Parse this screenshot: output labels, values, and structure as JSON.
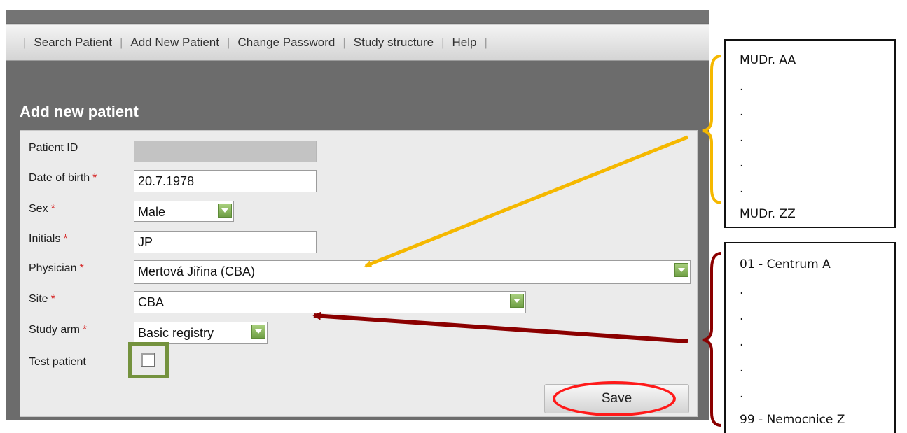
{
  "nav": {
    "items": [
      "Search Patient",
      "Add New Patient",
      "Change Password",
      "Study structure",
      "Help"
    ]
  },
  "page": {
    "title": "Add new patient"
  },
  "form": {
    "patient_id": {
      "label": "Patient ID",
      "value": ""
    },
    "date_of_birth": {
      "label": "Date of birth",
      "value": "20.7.1978"
    },
    "sex": {
      "label": "Sex",
      "value": "Male"
    },
    "initials": {
      "label": "Initials",
      "value": "JP"
    },
    "physician": {
      "label": "Physician",
      "value": "Mertová Jiřina (CBA)"
    },
    "site": {
      "label": "Site",
      "value": "CBA"
    },
    "study_arm": {
      "label": "Study arm",
      "value": "Basic registry"
    },
    "test_patient": {
      "label": "Test patient",
      "checked": false
    },
    "required_mark": "*",
    "save_label": "Save"
  },
  "annotations": {
    "physician_list": [
      "MUDr. AA",
      ".",
      ".",
      ".",
      ".",
      ".",
      "MUDr. ZZ"
    ],
    "site_list": [
      "01 - Centrum A",
      ".",
      ".",
      ".",
      ".",
      ".",
      "99 - Nemocnice Z"
    ],
    "colors": {
      "physician_arrow": "#f5b800",
      "site_arrow": "#8b0000",
      "save_highlight": "#ff1a1a",
      "checkbox_highlight": "#74923e"
    }
  }
}
